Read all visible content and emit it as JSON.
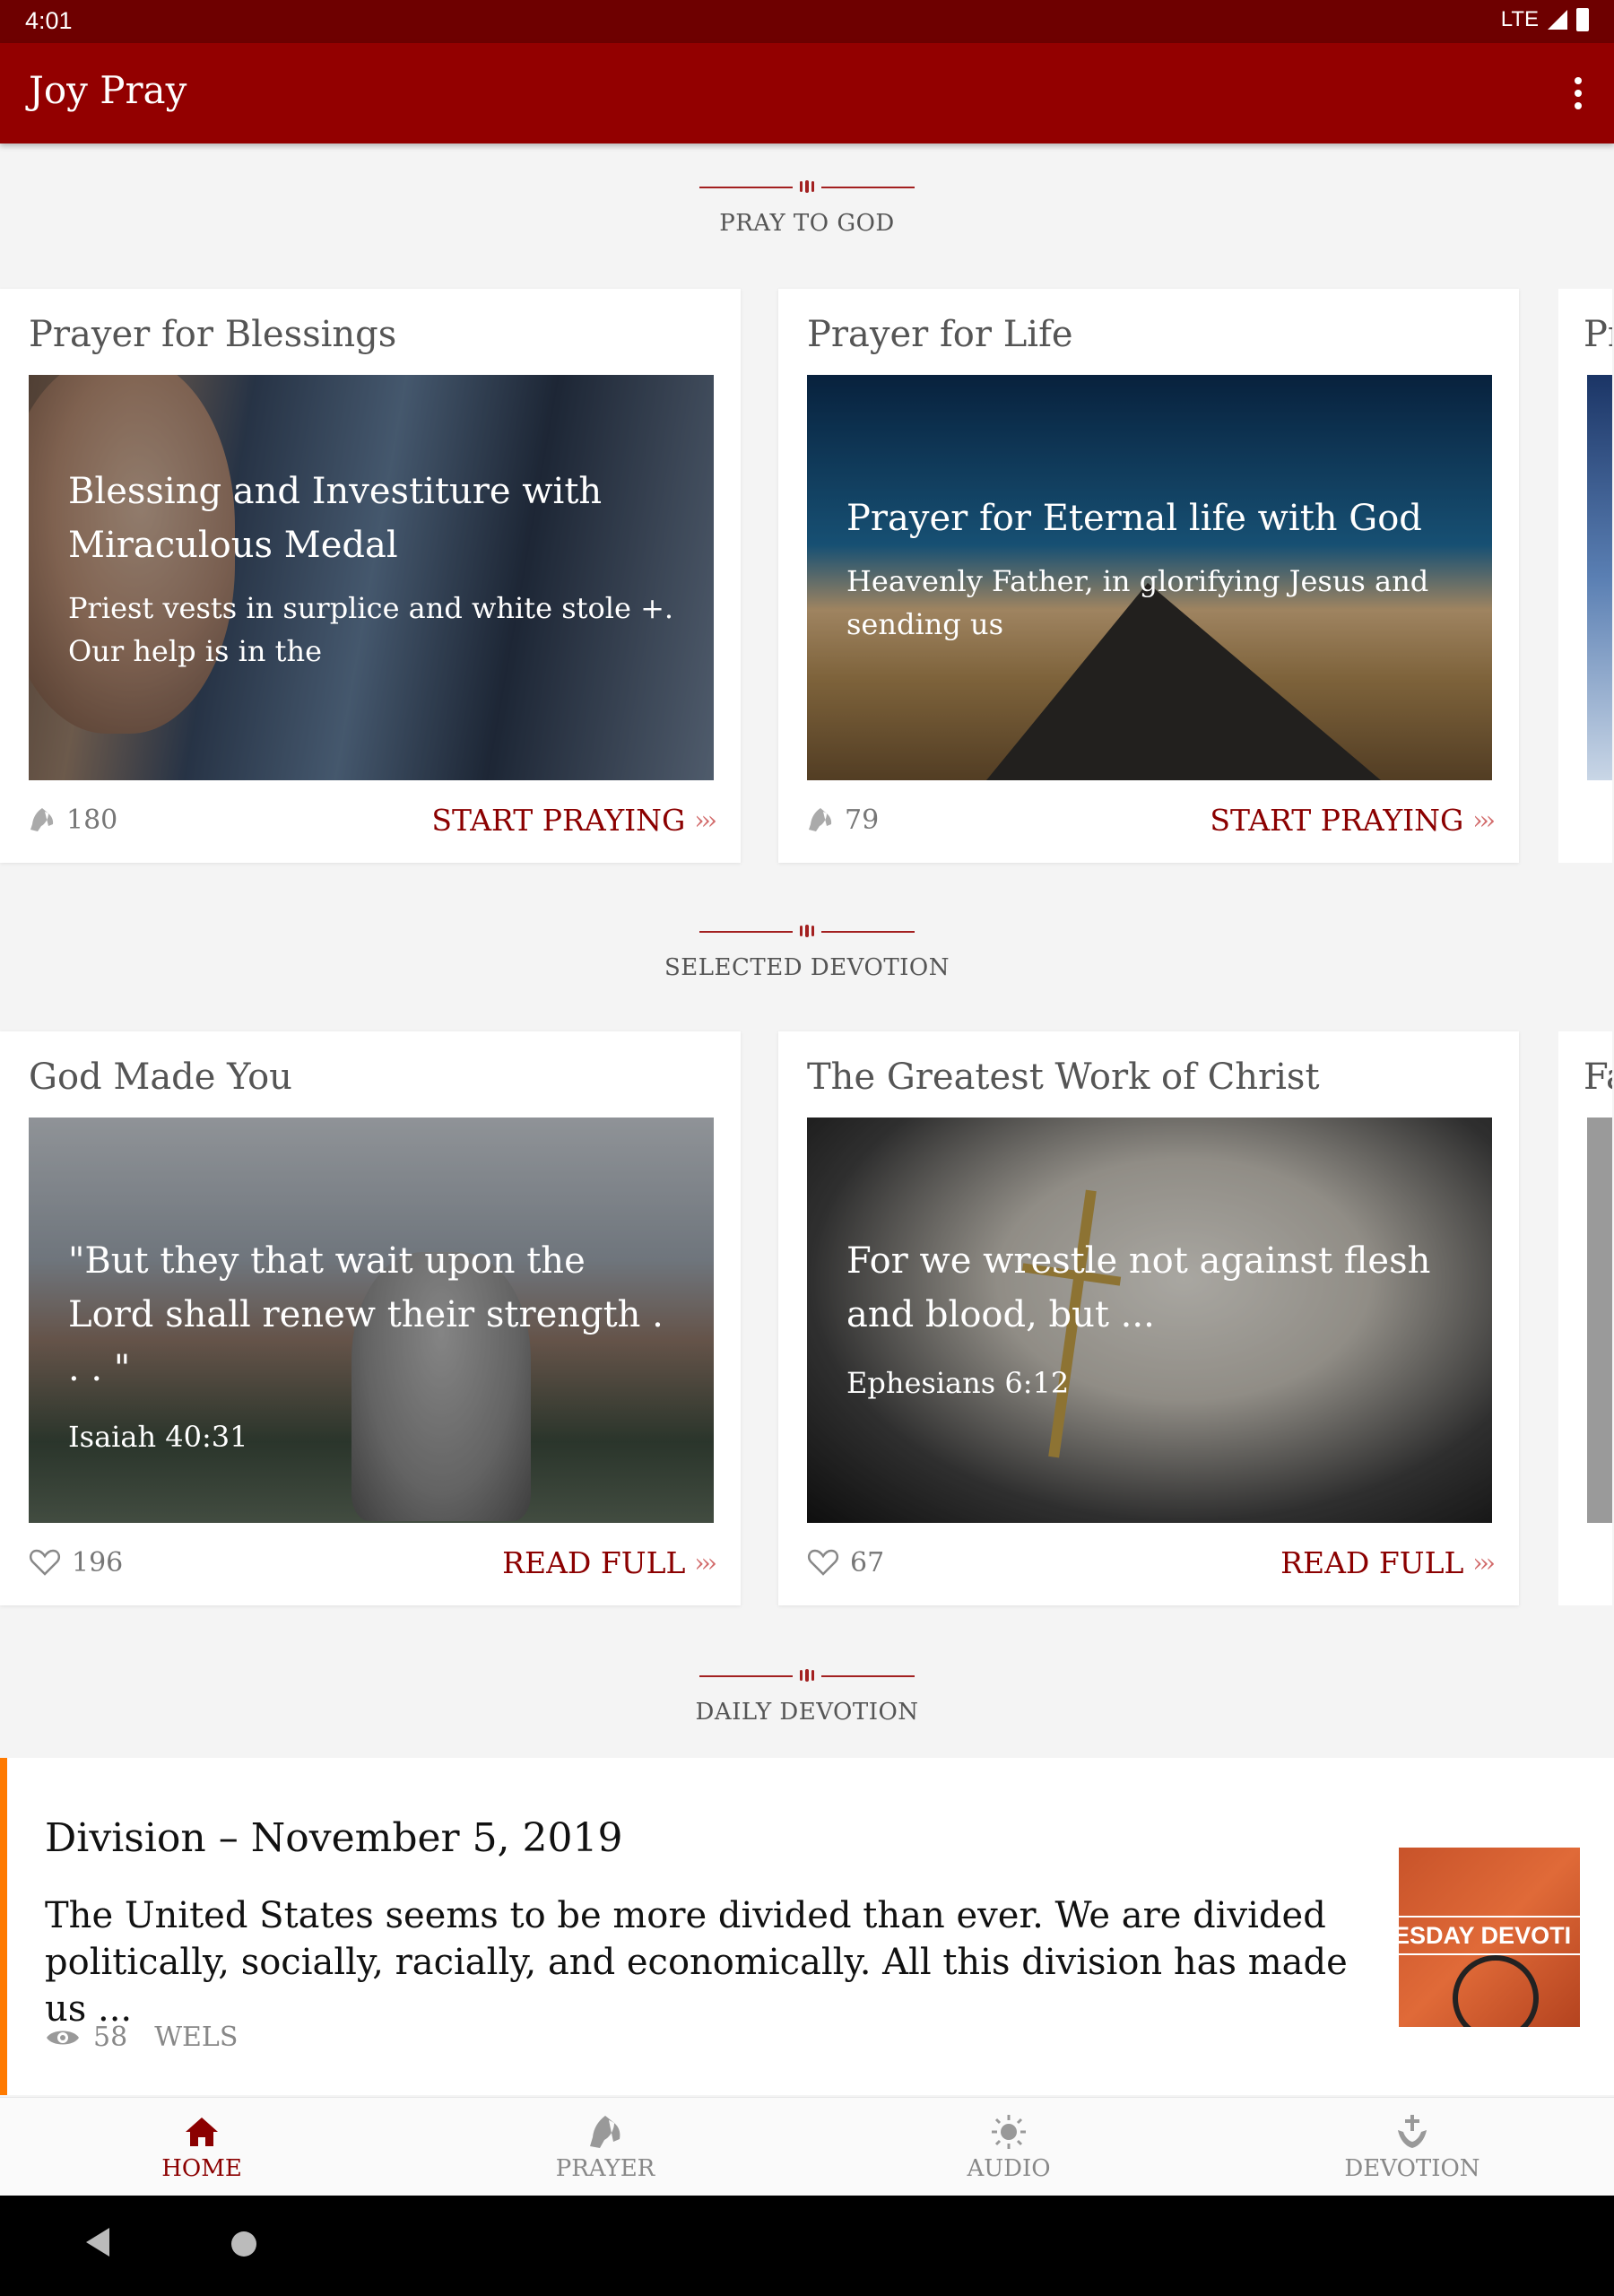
{
  "status_bar": {
    "time": "4:01",
    "network": "LTE"
  },
  "app_bar": {
    "title": "Joy Pray"
  },
  "sections": {
    "pray": "PRAY TO GOD",
    "selected": "SELECTED DEVOTION",
    "daily": "DAILY DEVOTION"
  },
  "prayers": [
    {
      "title": "Prayer for Blessings",
      "heading": "Blessing and Investiture with Miraculous Medal",
      "excerpt": "Priest vests in surplice and white stole  +. Our help is in the",
      "count": "180",
      "action": "START PRAYING"
    },
    {
      "title": "Prayer for Life",
      "heading": "Prayer for Eternal life with God",
      "excerpt": "Heavenly Father, in glorifying Jesus  and sending us",
      "count": "79",
      "action": "START PRAYING"
    }
  ],
  "prayer_peek_title": "Pr",
  "devotions": [
    {
      "title": "God Made You",
      "quote": "\"But they that wait upon the Lord shall renew their strength . . . \"",
      "reference": "Isaiah 40:31",
      "count": "196",
      "action": "READ FULL"
    },
    {
      "title": "The Greatest Work of Christ",
      "quote": "For we wrestle not against flesh and blood, but ...",
      "reference": "Ephesians 6:12",
      "count": "67",
      "action": "READ FULL"
    }
  ],
  "devotion_peek_title": "Fa",
  "daily_devotion": {
    "title": "Division – November 5, 2019",
    "text": "The United States seems to be more divided than ever. We are divided politically, socially, racially, and economically. All this division has made us ...",
    "views": "58",
    "source": "WELS",
    "thumb_text": "ESDAY DEVOTI"
  },
  "bottom_nav": {
    "home": "HOME",
    "prayer": "PRAYER",
    "audio": "AUDIO",
    "devotion": "DEVOTION"
  },
  "colors": {
    "status_bar": "#6e0000",
    "app_bar": "#930000",
    "accent": "#8b0000",
    "daily_border": "#ff7a00"
  }
}
